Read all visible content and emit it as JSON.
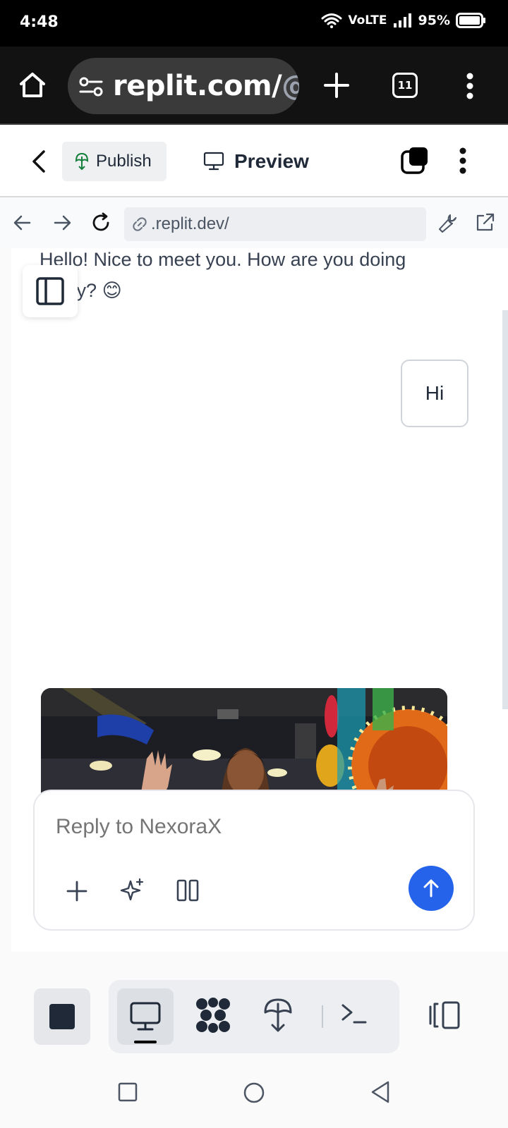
{
  "status_bar": {
    "time": "4:48",
    "network": "VoLTE",
    "battery": "95%"
  },
  "browser": {
    "url_main": "replit.com/",
    "url_dim": "@i",
    "tab_count": "11"
  },
  "toolbar": {
    "publish_label": "Publish",
    "preview_label": "Preview"
  },
  "preview_nav": {
    "url": ".replit.dev/"
  },
  "chat": {
    "assistant_message": "Hello! Nice to meet you. How are you doing today? 😊",
    "user_message": "Hi"
  },
  "composer": {
    "placeholder": "Reply to NexoraX"
  },
  "colors": {
    "send_button": "#2563eb",
    "publish_icon": "#15803d"
  }
}
